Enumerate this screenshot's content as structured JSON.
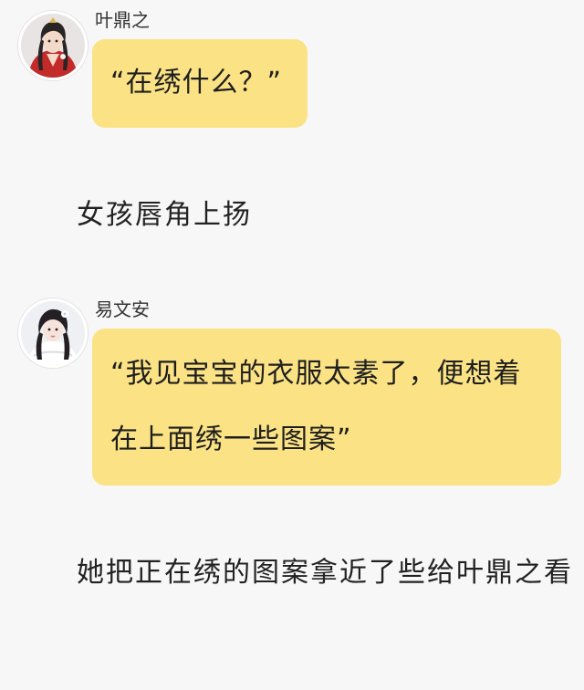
{
  "messages": [
    {
      "sender": "叶鼎之",
      "text": "“在绣什么？”"
    },
    {
      "sender": "易文安",
      "text": "“我见宝宝的衣服太素了，便想着在上面绣一些图案”"
    }
  ],
  "narration": [
    "女孩唇角上扬",
    "她把正在绣的图案拿近了些给叶鼎之看"
  ],
  "colors": {
    "background": "#f7f7f8",
    "bubble": "#fbe385",
    "text": "#222222"
  }
}
